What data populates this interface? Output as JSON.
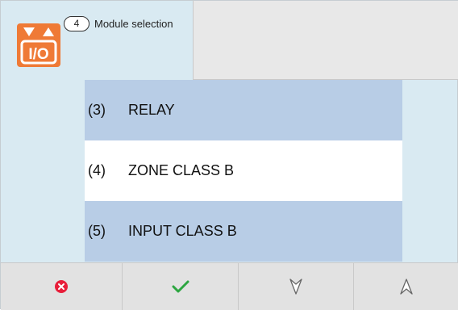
{
  "header": {
    "step_number": "4",
    "title": "Module selection",
    "icon": {
      "name": "io-module-icon",
      "label": "I/O",
      "color": "#ef7a36"
    }
  },
  "options": [
    {
      "number": "(3)",
      "label": "RELAY",
      "selected": false
    },
    {
      "number": "(4)",
      "label": "ZONE CLASS B",
      "selected": true
    },
    {
      "number": "(5)",
      "label": "INPUT CLASS B",
      "selected": false
    }
  ],
  "footer": {
    "buttons": [
      {
        "name": "cancel-button",
        "icon": "cancel-icon",
        "color": "#e81e3a"
      },
      {
        "name": "confirm-button",
        "icon": "check-icon",
        "color": "#2da641"
      },
      {
        "name": "scroll-down-button",
        "icon": "down-arrow-icon",
        "color": "#666666"
      },
      {
        "name": "scroll-up-button",
        "icon": "up-arrow-icon",
        "color": "#666666"
      }
    ]
  },
  "colors": {
    "background": "#d9eaf2",
    "item_unselected": "#b8cde6",
    "item_selected": "#ffffff",
    "footer": "#e2e2e2"
  }
}
